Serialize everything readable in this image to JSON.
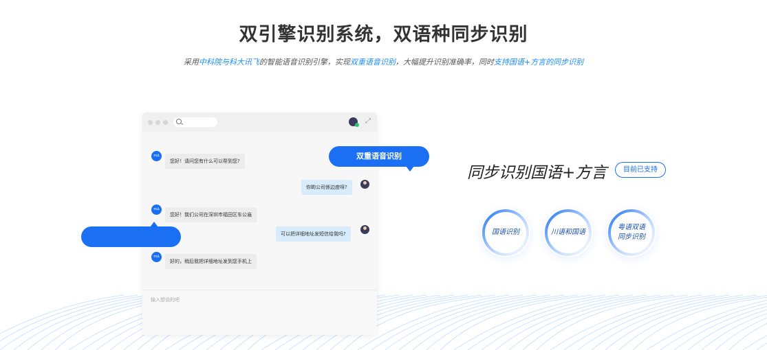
{
  "header": {
    "title": "双引擎识别系统，双语种同步识别",
    "subtitle_parts": {
      "p1": "采用",
      "h1": "中科院与科大讯飞",
      "p2": "的智能语音识别引擎，实现",
      "h2": "双重语音识别",
      "p3": "，大幅提升识别准确率，同时",
      "h3": "支持国语+方言的同步识别"
    }
  },
  "chat_window": {
    "bot_avatar_text": "m∆",
    "messages": [
      {
        "side": "left",
        "text": "您好！请问您有什么可以帮到您?"
      },
      {
        "side": "right",
        "text": "你啲公司係边度呀?"
      },
      {
        "side": "left",
        "text": "您好！我们公司在深圳市福田区车公庙"
      },
      {
        "side": "right",
        "text": "可以把详细地址发短信给我吗?"
      },
      {
        "side": "left",
        "text": "好的，稍后我把详细地址发到您手机上"
      }
    ],
    "input_placeholder": "输入想说的吧"
  },
  "callout": {
    "label": "双重语音识别"
  },
  "feature": {
    "headline": "同步识别国语+方言",
    "badge": "目前已支持",
    "rings": [
      {
        "label_line1": "国语识别",
        "label_line2": ""
      },
      {
        "label_line1": "川语和国语",
        "label_line2": ""
      },
      {
        "label_line1": "粤语双语",
        "label_line2": "同步识别"
      }
    ]
  },
  "colors": {
    "accent": "#1a6ff2",
    "highlight_text": "#1a8cff",
    "ring_gradient_start": "#1a6ff2",
    "ring_gradient_end": "#cfe3ff"
  }
}
